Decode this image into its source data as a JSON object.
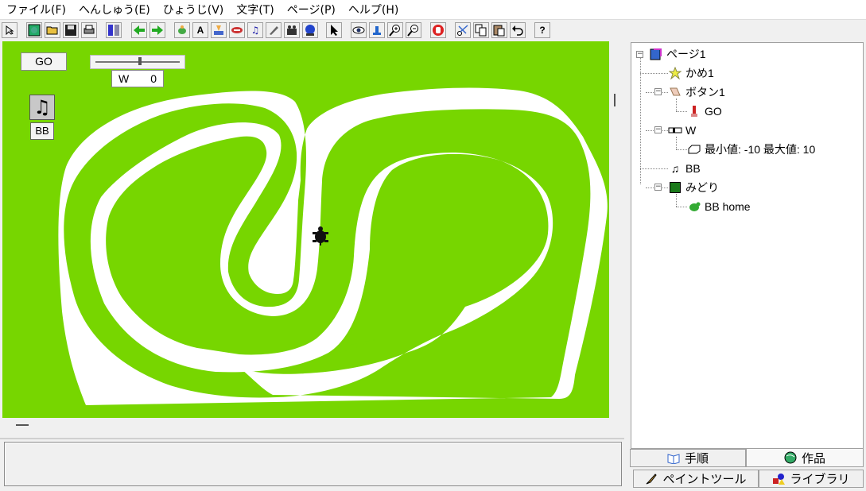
{
  "menu": [
    "ファイル(F)",
    "へんしゅう(E)",
    "ひょうじ(V)",
    "文字(T)",
    "ページ(P)",
    "ヘルプ(H)"
  ],
  "toolbar": {
    "help_glyph": "?",
    "text_glyph": "A",
    "icons": [
      "select-arrow-icon",
      "new-page-icon",
      "open-folder-icon",
      "save-icon",
      "print-icon",
      "page-view-icon",
      "back-arrow-icon",
      "forward-arrow-icon",
      "turtle-tool-icon",
      "text-tool-icon",
      "button-tool-icon",
      "slider-tool-icon",
      "music-tool-icon",
      "pen-tool-icon",
      "video-tool-icon",
      "globe-tool-icon",
      "pointer-icon",
      "eye-icon",
      "stamp-icon",
      "zoom-in-icon",
      "zoom-out-icon",
      "stop-hand-icon",
      "cut-icon",
      "copy-icon",
      "paste-icon",
      "undo-icon",
      "help-icon"
    ]
  },
  "stage": {
    "go_label": "GO",
    "slider_name": "W",
    "slider_value": "0",
    "music_label": "BB",
    "colors": {
      "background": "#77d600",
      "track": "#ffffff"
    }
  },
  "tree": {
    "page": "ページ1",
    "turtle": "かめ1",
    "button": "ボタン1",
    "button_child": "GO",
    "slider": "W",
    "slider_child": "最小値: -10  最大値: 10",
    "music": "BB",
    "color": "みどり",
    "color_child": "BB home"
  },
  "tabs": {
    "procedure": "手順",
    "work": "作品",
    "paint": "ペイントツール",
    "library": "ライブラリ"
  }
}
